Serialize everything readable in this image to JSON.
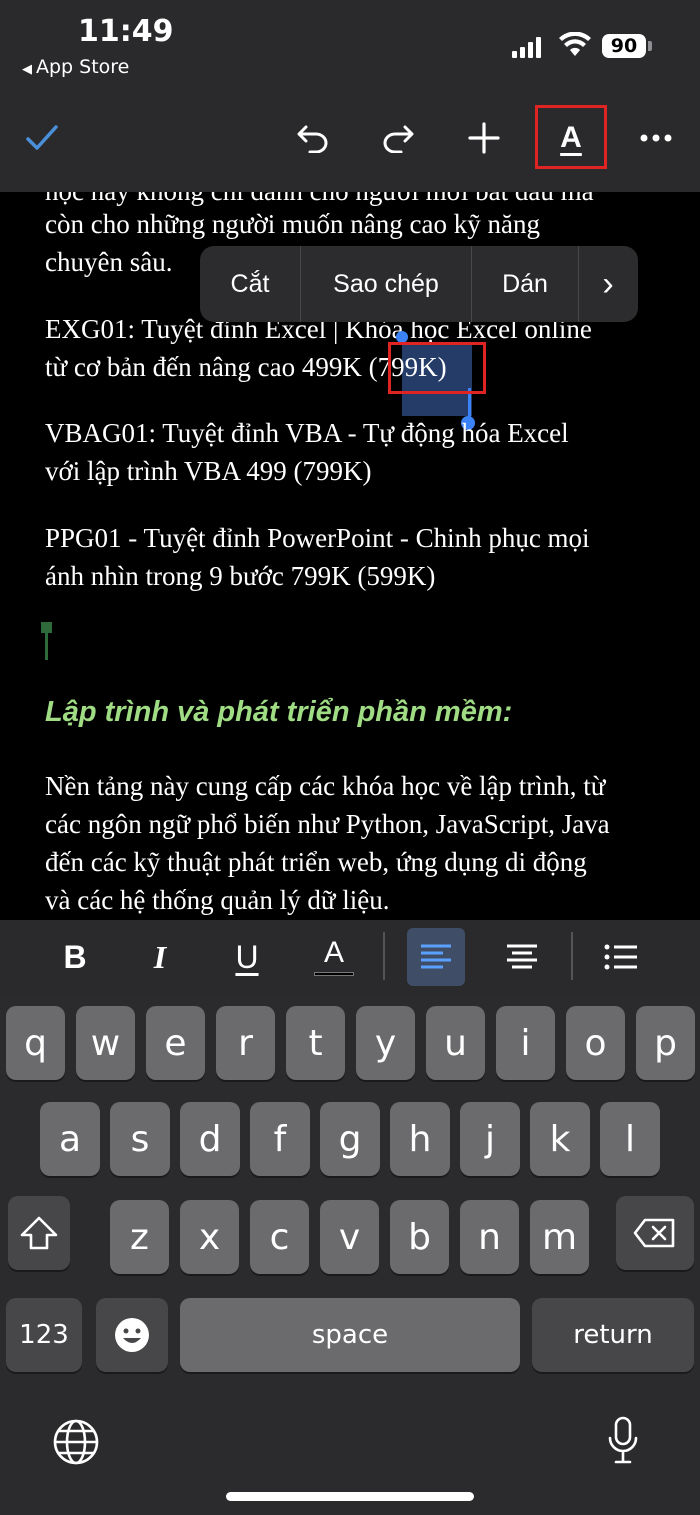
{
  "status": {
    "time": "11:49",
    "back_label": "App Store",
    "battery": "90"
  },
  "toolbar": {
    "done_icon": "checkmark-icon",
    "undo_icon": "undo-icon",
    "redo_icon": "redo-icon",
    "insert_icon": "plus-icon",
    "format_label": "A",
    "more_icon": "ellipsis-icon"
  },
  "document": {
    "line1": "học này không chỉ dành cho người mới bắt đầu mà",
    "line2": "còn cho những người muốn nâng cao kỹ năng",
    "line3": "chuyên sâu.",
    "exg_line1": "EXG01: Tuyệt đỉnh Excel | Khóa học Excel online",
    "exg_line2_pre": "từ cơ bản đến nâng cao 499K ",
    "exg_line2_sel": "(799K)",
    "vba_line1": "VBAG01: Tuyệt đỉnh VBA - Tự động hóa Excel",
    "vba_line2": "với lập trình VBA 499 (799K)",
    "ppg_line1": "PPG01 - Tuyệt đỉnh PowerPoint - Chinh phục mọi",
    "ppg_line2": "ánh nhìn trong 9 bước 799K (599K)",
    "heading": "Lập trình và phát triển phần mềm:",
    "para_line1": "Nền tảng này cung cấp các khóa học về lập trình, từ",
    "para_line2": "các ngôn ngữ phổ biến như Python, JavaScript, Java",
    "para_line3": "đến các kỹ thuật phát triển web, ứng dụng di động",
    "para_line4": "và các hệ thống quản lý dữ liệu."
  },
  "context_menu": {
    "cut": "Cắt",
    "copy": "Sao chép",
    "paste": "Dán",
    "more": "›"
  },
  "format_bar": {
    "bold": "B",
    "italic": "I",
    "underline": "U",
    "color": "A"
  },
  "keyboard": {
    "row1": [
      "q",
      "w",
      "e",
      "r",
      "t",
      "y",
      "u",
      "i",
      "o",
      "p"
    ],
    "row2": [
      "a",
      "s",
      "d",
      "f",
      "g",
      "h",
      "j",
      "k",
      "l"
    ],
    "row3": [
      "z",
      "x",
      "c",
      "v",
      "b",
      "n",
      "m"
    ],
    "numbers": "123",
    "space": "space",
    "return": "return"
  },
  "colors": {
    "heading": "#9fdc84",
    "selection": "#3b82f6",
    "highlight_box": "#e02424",
    "accent": "#4a8fd9"
  }
}
